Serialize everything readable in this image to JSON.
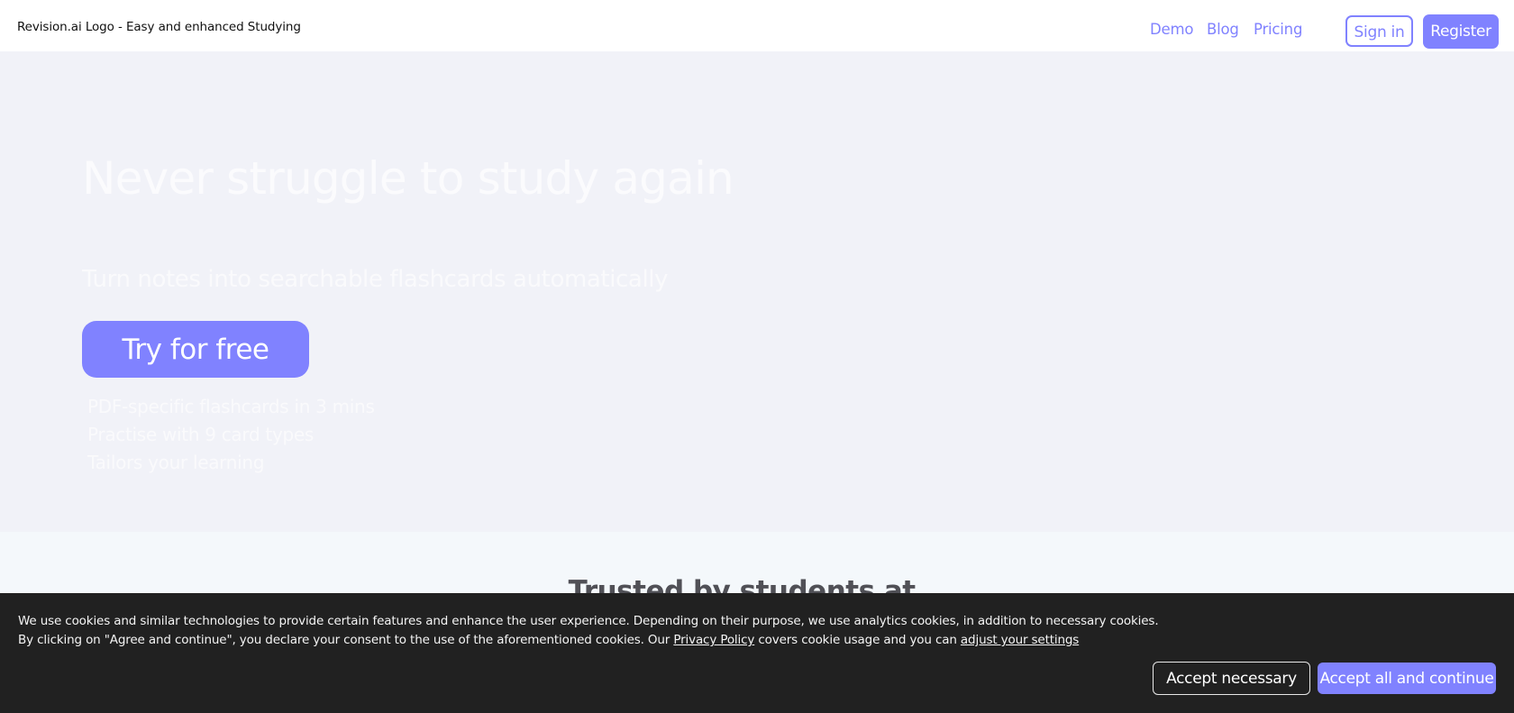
{
  "header": {
    "logo_alt": "Revision.ai Logo - Easy and enhanced Studying",
    "nav": [
      {
        "label": "Demo"
      },
      {
        "label": "Blog"
      },
      {
        "label": "Pricing"
      }
    ],
    "sign_in_label": "Sign in",
    "register_label": "Register"
  },
  "hero": {
    "title": "Never struggle to study again",
    "subtitle": "Turn notes into searchable flashcards automatically",
    "cta_label": "Try for free",
    "features": [
      "PDF-specific flashcards in 3 mins",
      "Practise with 9 card types",
      "Tailors your learning"
    ]
  },
  "trusted": {
    "title": "Trusted by students at...",
    "logos": [
      {
        "icon": "university-logo-broken-image"
      },
      {
        "icon": "university-logo-broken-image"
      },
      {
        "icon": "university-logo-broken-image"
      },
      {
        "icon": "university-logo-broken-image"
      },
      {
        "icon": "university-logo-broken-image"
      }
    ]
  },
  "cookie_banner": {
    "line1": "We use cookies and similar technologies to provide certain features and enhance the user experience. Depending on their purpose, we use analytics cookies, in addition to necessary cookies.",
    "line2_prefix": "By clicking on \"Agree and continue\", you declare your consent to the use of the aforementioned cookies. Our ",
    "privacy_link": "Privacy Policy",
    "line2_middle": " covers cookie usage and you can ",
    "settings_link": "adjust your settings",
    "accept_necessary_label": "Accept necessary",
    "accept_all_label": "Accept all and continue"
  },
  "colors": {
    "accent": "#8082ff",
    "hero_bg": "#f1f2f8",
    "trusted_bg": "#f4f8fb",
    "banner_bg": "#212121"
  }
}
